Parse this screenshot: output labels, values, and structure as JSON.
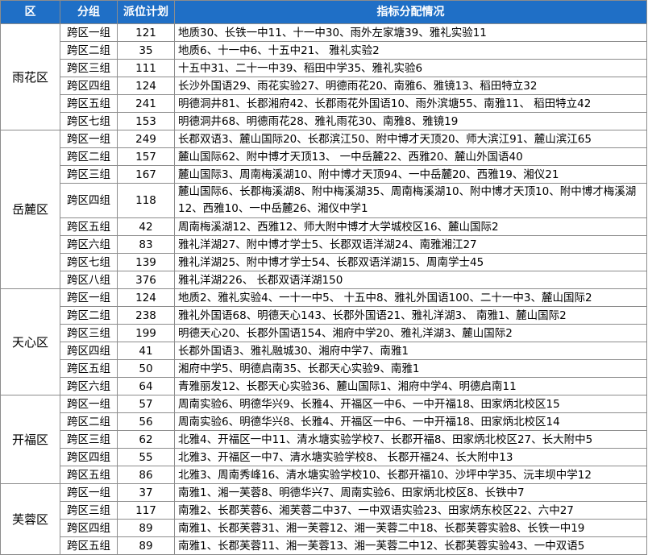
{
  "header": {
    "district": "区",
    "group": "分组",
    "plan": "派位计划",
    "detail": "指标分配情况"
  },
  "districts": [
    {
      "name": "雨花区",
      "rows": [
        {
          "group": "跨区一组",
          "plan": "121",
          "detail": "地质30、长铁一中11、十一中30、雨外左家塘39、雅礼实验11"
        },
        {
          "group": "跨区二组",
          "plan": "35",
          "detail": "地质6、十一中6、十五中21、 雅礼实验2"
        },
        {
          "group": "跨区三组",
          "plan": "111",
          "detail": "十五中31、二十一中39、稻田中学35、雅礼实验6"
        },
        {
          "group": "跨区四组",
          "plan": "124",
          "detail": "长沙外国语29、雨花实验27、明德雨花20、南雅6、雅镜13、稻田特立32"
        },
        {
          "group": "跨区五组",
          "plan": "241",
          "detail": "明德洞井81、长郡湘府42、长郡雨花外国语10、雨外滨塘55、南雅11、 稻田特立42"
        },
        {
          "group": "跨区七组",
          "plan": "153",
          "detail": "明德洞井68、明德雨花28、雅礼雨花30、南雅8、雅镜19"
        }
      ]
    },
    {
      "name": "岳麓区",
      "rows": [
        {
          "group": "跨区一组",
          "plan": "249",
          "detail": "长郡双语3、麓山国际20、长郡滨江50、附中博才天顶20、师大滨江91、麓山滨江65"
        },
        {
          "group": "跨区二组",
          "plan": "157",
          "detail": "麓山国际62、附中博才天顶13、 一中岳麓22、西雅20、麓山外国语40"
        },
        {
          "group": "跨区三组",
          "plan": "167",
          "detail": "麓山国际3、周南梅溪湖10、附中博才天顶94、一中岳麓20、西雅19、湘仪21"
        },
        {
          "group": "跨区四组",
          "plan": "118",
          "detail": "麓山国际6、长郡梅溪湖8、附中梅溪湖35、周南梅溪湖10、附中博才天顶10、附中博才梅溪湖12、西雅10、一中岳麓26、湘仪中学1",
          "wrap": true
        },
        {
          "group": "跨区五组",
          "plan": "42",
          "detail": "周南梅溪湖12、西雅12、师大附中博才大学城校区16、麓山国际2"
        },
        {
          "group": "跨区六组",
          "plan": "83",
          "detail": "雅礼洋湖27、附中博才学士5、长郡双语洋湖24、南雅湘江27"
        },
        {
          "group": "跨区七组",
          "plan": "139",
          "detail": "雅礼洋湖25、附中博才学士54、长郡双语洋湖15、周南学士45"
        },
        {
          "group": "跨区八组",
          "plan": "376",
          "detail": "雅礼洋湖226、 长郡双语洋湖150"
        }
      ]
    },
    {
      "name": "天心区",
      "rows": [
        {
          "group": "跨区一组",
          "plan": "124",
          "detail": "地质2、雅礼实验4、一十一中5、 十五中8、雅礼外国语100、二十一中3、麓山国际2"
        },
        {
          "group": "跨区二组",
          "plan": "238",
          "detail": "雅礼外国语68、明德天心143、长郡外国语21、雅礼洋湖3、 南雅1、麓山国际2"
        },
        {
          "group": "跨区三组",
          "plan": "199",
          "detail": "明德天心20、长郡外国语154、湘府中学20、雅礼洋湖3、麓山国际2"
        },
        {
          "group": "跨区四组",
          "plan": "41",
          "detail": "长郡外国语3、雅礼融城30、湘府中学7、南雅1"
        },
        {
          "group": "跨区五组",
          "plan": "50",
          "detail": "湘府中学5、明德启南35、长郡天心实验9、南雅1"
        },
        {
          "group": "跨区六组",
          "plan": "64",
          "detail": "青雅丽发12、长郡天心实验36、麓山国际1、湘府中学4、明德启南11"
        }
      ]
    },
    {
      "name": "开福区",
      "rows": [
        {
          "group": "跨区一组",
          "plan": "57",
          "detail": "周南实验6、明德华兴9、长雅4、开福区一中6、一中开福18、田家炳北校区15"
        },
        {
          "group": "跨区二组",
          "plan": "56",
          "detail": "周南实验6、明德华兴8、长雅4、开福区一中6、一中开福18、田家炳北校区14"
        },
        {
          "group": "跨区三组",
          "plan": "62",
          "detail": "北雅4、开福区一中11、清水塘实验学校7、长郡开福8、田家炳北校区27、长大附中5"
        },
        {
          "group": "跨区四组",
          "plan": "55",
          "detail": "北雅3、开福区一中7、清水塘实验学校8、 长郡开福24、长大附中13"
        },
        {
          "group": "跨区五组",
          "plan": "86",
          "detail": "北雅3、周南秀峰16、清水塘实验学校10、长郡开福10、沙坪中学35、沅丰坝中学12"
        }
      ]
    },
    {
      "name": "芙蓉区",
      "rows": [
        {
          "group": "跨区一组",
          "plan": "37",
          "detail": "南雅1、湘一芙蓉8、明德华兴7、周南实验6、田家炳北校区8、长铁中7"
        },
        {
          "group": "跨区三组",
          "plan": "117",
          "detail": "南雅2、长郡芙蓉6、湘芙蓉二中37、一中双语实验23、田家炳东校区22、六中27"
        },
        {
          "group": "跨区四组",
          "plan": "89",
          "detail": "南雅1、长郡芙蓉31、湘一芙蓉12、湘一芙蓉二中18、长郡芙蓉实验8、长铁一中19"
        },
        {
          "group": "跨区五组",
          "plan": "89",
          "detail": "南雅1、长郡芙蓉11、湘一芙蓉13、湘一芙蓉二中12、长郡芙蓉实验43、一中双语5"
        }
      ]
    }
  ]
}
